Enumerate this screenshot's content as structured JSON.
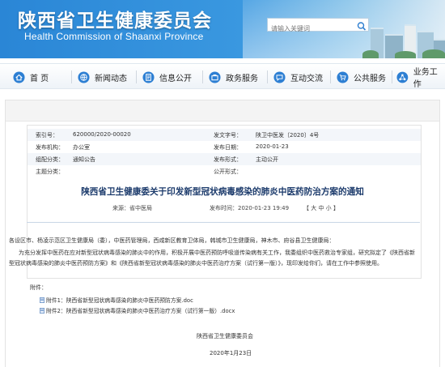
{
  "header": {
    "title": "陕西省卫生健康委员会",
    "subtitle": "Health Commission of Shaanxi Province",
    "search_placeholder": "请输入关键词"
  },
  "nav": {
    "items": [
      {
        "label": "首  页",
        "icon": "home-icon"
      },
      {
        "label": "新闻动态",
        "icon": "globe-icon"
      },
      {
        "label": "信息公开",
        "icon": "document-icon"
      },
      {
        "label": "政务服务",
        "icon": "briefcase-icon"
      },
      {
        "label": "互动交流",
        "icon": "chat-icon"
      },
      {
        "label": "公共服务",
        "icon": "cart-icon"
      },
      {
        "label": "业务工作",
        "icon": "network-icon"
      }
    ]
  },
  "meta": {
    "rows": [
      {
        "l1": "索引号：",
        "v1": "620000/2020-00020",
        "l2": "发文字号：",
        "v2": "陕卫中医发〔2020〕4号"
      },
      {
        "l1": "发布机构：",
        "v1": "办公室",
        "l2": "发布日期：",
        "v2": "2020-01-23"
      },
      {
        "l1": "组配分类：",
        "v1": "通知公告",
        "l2": "发布形式：",
        "v2": "主动公开"
      },
      {
        "l1": "主题分类：",
        "v1": "",
        "l2": "公开形式：",
        "v2": ""
      }
    ]
  },
  "article": {
    "title": "陕西省卫生健康委关于印发新型冠状病毒感染的肺炎中医药防治方案的通知",
    "source": "来源：省中医局",
    "date": "发布时间：2020-01-23 19:49",
    "font_size_label": "【 大 中 小 】",
    "recipients": "各设区市、杨凌示范区卫生健康局（委），中医药管理局，西咸新区教育卫体局，韩城市卫生健康局，神木市、府谷县卫生健康局：",
    "body_line1": "为充分发挥中医药在应对新型冠状病毒感染的肺炎中的作用，积极开展中医药预防呼吸道传染病有关工作，我委组织中医药救治专家组，研究拟定了《陕西省新",
    "body_line2": "型冠状病毒感染的肺炎中医药预防方案》和《陕西省新型冠状病毒感染的肺炎中医药治疗方案（试行第一版）》，现印发给你们，请在工作中参照使用。",
    "attachments_label": "附件：",
    "attachments": [
      "附件1：陕西省新型冠状病毒感染的肺炎中医药预防方案.doc",
      "附件2：陕西省新型冠状病毒感染的肺炎中医药治疗方案（试行第一版）.docx"
    ],
    "signature_org": "陕西省卫生健康委员会",
    "signature_date": "2020年1月23日"
  }
}
